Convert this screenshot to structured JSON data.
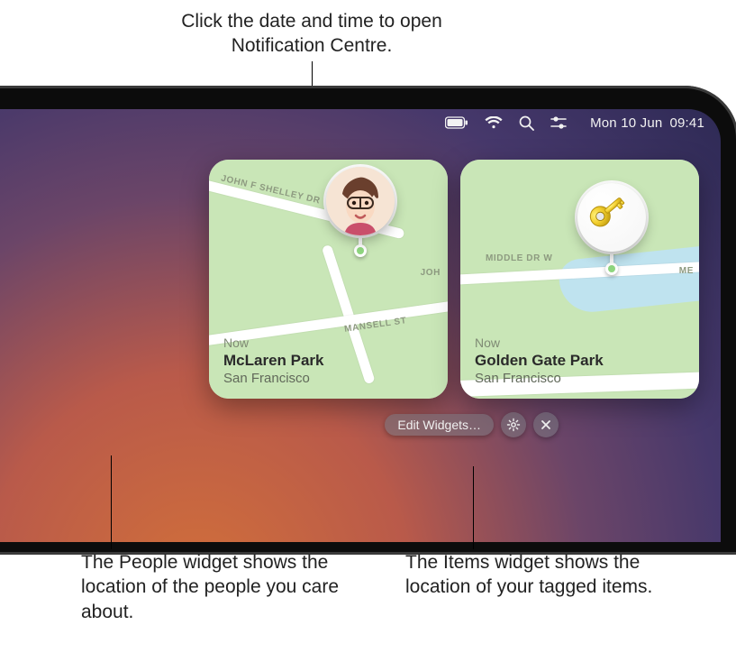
{
  "callouts": {
    "top": "Click the date and time to open Notification Centre.",
    "bottom_left": "The People widget shows the location of the people you care about.",
    "bottom_right": "The Items widget shows the location of your tagged items."
  },
  "menubar": {
    "date": "Mon 10 Jun",
    "time": "09:41"
  },
  "widget_controls": {
    "edit_label": "Edit Widgets…"
  },
  "widgets": {
    "people": {
      "timestamp": "Now",
      "place": "McLaren Park",
      "city": "San Francisco",
      "roads": {
        "a": "John F Shelley Dr",
        "b": "Joh",
        "c": "Mansell St"
      }
    },
    "items": {
      "timestamp": "Now",
      "place": "Golden Gate Park",
      "city": "San Francisco",
      "roads": {
        "a": "Middle Dr W",
        "b": "Me"
      }
    }
  }
}
